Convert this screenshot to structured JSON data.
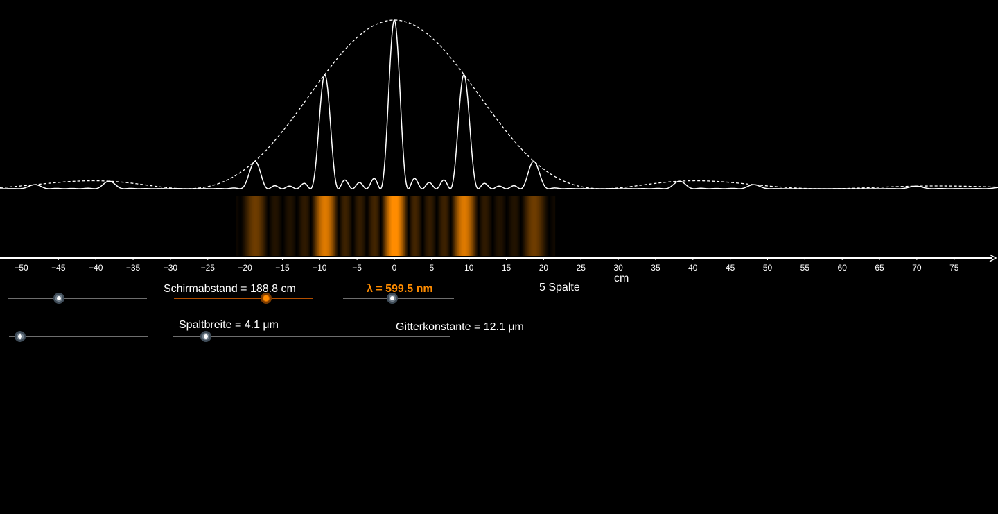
{
  "sliders": [
    {
      "id": "slit-count",
      "label": "",
      "value_fraction": 0.37,
      "active": false
    },
    {
      "id": "screen-distance",
      "label": "Schirmabstand = 188.8 cm",
      "value_fraction": 0.66,
      "active": true
    },
    {
      "id": "wavelength",
      "label": "λ = 599.5 nm",
      "value_fraction": 0.44,
      "active": false
    },
    {
      "id": "unused",
      "label": "",
      "value_fraction": 0.08,
      "active": false
    },
    {
      "id": "slit-width",
      "label": "Spaltbreite = 4.1 μm",
      "value_fraction": 0.12,
      "active": false
    }
  ],
  "labels": {
    "slit_count": "5 Spalte",
    "grating_constant": "Gitterkonstante = 12.1 μm",
    "axis_unit": "cm"
  },
  "colors": {
    "background": "#000000",
    "curve": "#ffffff",
    "light": "#ff8c00"
  },
  "chart_data": {
    "type": "line",
    "xlabel": "cm",
    "xlim": [
      -52,
      80
    ],
    "x_ticks": [
      -50,
      -45,
      -40,
      -35,
      -30,
      -25,
      -20,
      -15,
      -10,
      -5,
      0,
      5,
      10,
      15,
      20,
      25,
      30,
      35,
      40,
      45,
      50,
      55,
      60,
      65,
      70,
      75
    ],
    "params": {
      "slits": 5,
      "screen_distance_cm": 188.8,
      "wavelength_nm": 599.5,
      "slit_width_um": 4.1,
      "grating_constant_um": 12.1
    },
    "series": [
      {
        "style": "solid",
        "role": "grating-intensity"
      },
      {
        "style": "dashed",
        "role": "single-slit-envelope"
      }
    ]
  }
}
